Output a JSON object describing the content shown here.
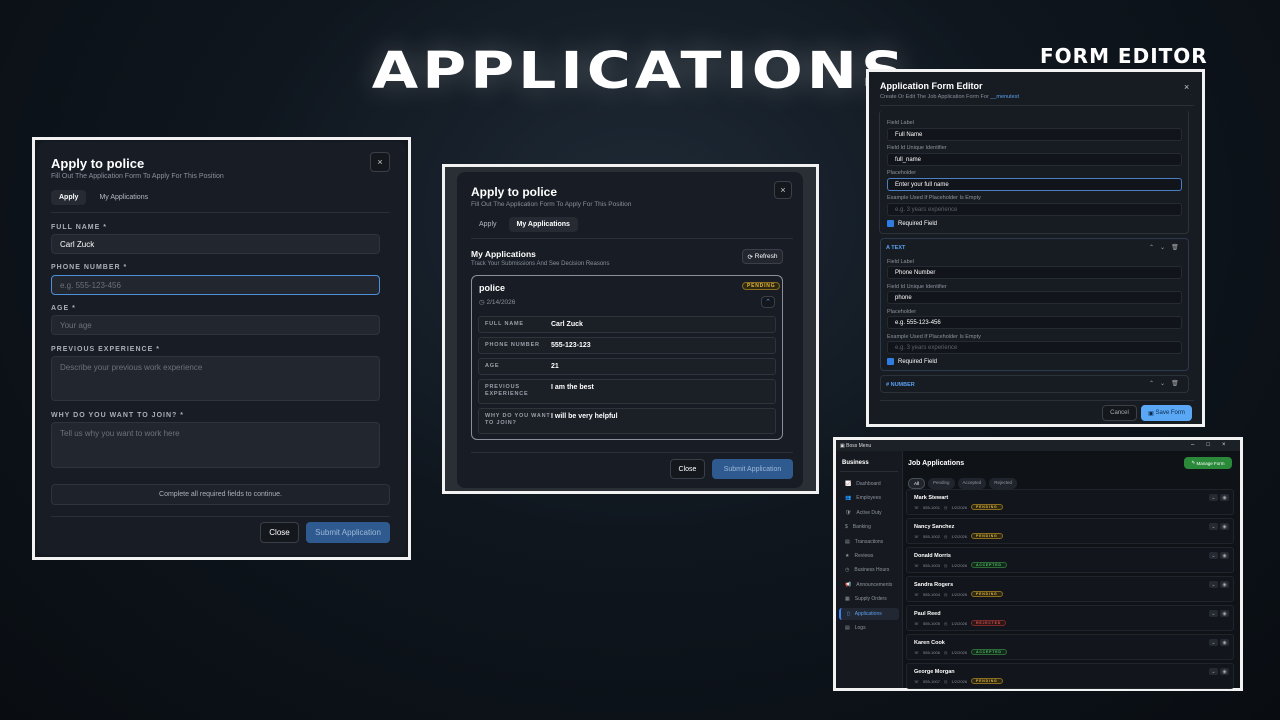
{
  "hero": {
    "title": "APPLICATIONS",
    "form_editor_caption": "FORM EDITOR"
  },
  "apply_modal": {
    "title": "Apply to police",
    "subtitle": "Fill Out The Application Form To Apply For This Position",
    "close": "×",
    "tabs": [
      "Apply",
      "My Applications"
    ],
    "fields": [
      {
        "label": "FULL NAME *",
        "value": "Carl Zuck",
        "placeholder": ""
      },
      {
        "label": "PHONE NUMBER *",
        "value": "",
        "placeholder": "e.g. 555-123-456"
      },
      {
        "label": "AGE *",
        "value": "",
        "placeholder": "Your age"
      },
      {
        "label": "PREVIOUS EXPERIENCE *",
        "value": "",
        "placeholder": "Describe your previous work experience"
      },
      {
        "label": "WHY DO YOU WANT TO JOIN? *",
        "value": "",
        "placeholder": "Tell us why you want to work here"
      }
    ],
    "notice": "Complete all required fields to continue.",
    "close_label": "Close",
    "submit_label": "Submit Application"
  },
  "my_apps_modal": {
    "title": "Apply to police",
    "subtitle": "Fill Out The Application Form To Apply For This Position",
    "close": "×",
    "tabs": [
      "Apply",
      "My Applications"
    ],
    "section_title": "My Applications",
    "section_subtitle": "Track Your Submissions And See Decision Reasons",
    "refresh": "Refresh",
    "application": {
      "job": "police",
      "status": "PENDING",
      "date": "2/14/2026",
      "answers": [
        {
          "k": "FULL NAME",
          "v": "Carl Zuck"
        },
        {
          "k": "PHONE NUMBER",
          "v": "555-123-123"
        },
        {
          "k": "AGE",
          "v": "21"
        },
        {
          "k": "PREVIOUS EXPERIENCE",
          "v": "I am the best"
        },
        {
          "k": "WHY DO YOU WANT TO JOIN?",
          "v": "I will be very helpful"
        }
      ]
    },
    "close_label": "Close",
    "submit_label": "Submit Application"
  },
  "form_editor": {
    "title": "Application Form Editor",
    "subtitle": "Create Or Edit The Job Application Form For ",
    "job": "__menutest",
    "close": "×",
    "labels": {
      "field_label": "Field Label",
      "field_id": "Field Id Unique Identifier",
      "placeholder": "Placeholder",
      "example": "Example Used If Placeholder Is Empty",
      "required": "Required Field"
    },
    "example_placeholder": "e.g. 3 years experience",
    "fields": [
      {
        "type": "",
        "label": "Full Name",
        "id": "full_name",
        "placeholder": "Enter your full name"
      },
      {
        "type": "TEXT",
        "label": "Phone Number",
        "id": "phone",
        "placeholder": "e.g. 555-123-456"
      },
      {
        "type": "NUMBER"
      }
    ],
    "cancel": "Cancel",
    "save": "Save Form"
  },
  "boss_menu": {
    "window_title": "Boss Menu",
    "section": "Business",
    "heading": "Job Applications",
    "manage": "Manage Form",
    "sidebar": [
      {
        "label": "Dashboard",
        "icon": "📈"
      },
      {
        "label": "Employees",
        "icon": "👥"
      },
      {
        "label": "Active Duty",
        "icon": "🛡"
      },
      {
        "label": "Banking",
        "icon": "$"
      },
      {
        "label": "Transactions",
        "icon": "▤"
      },
      {
        "label": "Reviews",
        "icon": "★"
      },
      {
        "label": "Business Hours",
        "icon": "◷"
      },
      {
        "label": "Announcements",
        "icon": "📢"
      },
      {
        "label": "Supply Orders",
        "icon": "▦"
      },
      {
        "label": "Applications",
        "icon": "▯"
      },
      {
        "label": "Logs",
        "icon": "▤"
      }
    ],
    "active": "Applications",
    "filters": [
      "All",
      "Pending",
      "Accepted",
      "Rejected"
    ],
    "applicants": [
      {
        "name": "Mark Stewart",
        "phone": "555-1001",
        "date": "1/2/2026",
        "status": "PENDING"
      },
      {
        "name": "Nancy Sanchez",
        "phone": "555-1002",
        "date": "1/2/2026",
        "status": "PENDING"
      },
      {
        "name": "Donald Morris",
        "phone": "555-1003",
        "date": "1/2/2026",
        "status": "ACCEPTED"
      },
      {
        "name": "Sandra Rogers",
        "phone": "555-1004",
        "date": "1/2/2026",
        "status": "PENDING"
      },
      {
        "name": "Paul Reed",
        "phone": "555-1005",
        "date": "1/2/2026",
        "status": "REJECTED"
      },
      {
        "name": "Karen Cook",
        "phone": "555-1006",
        "date": "1/2/2026",
        "status": "ACCEPTED"
      },
      {
        "name": "George Morgan",
        "phone": "555-1007",
        "date": "1/2/2026",
        "status": "PENDING"
      }
    ]
  }
}
